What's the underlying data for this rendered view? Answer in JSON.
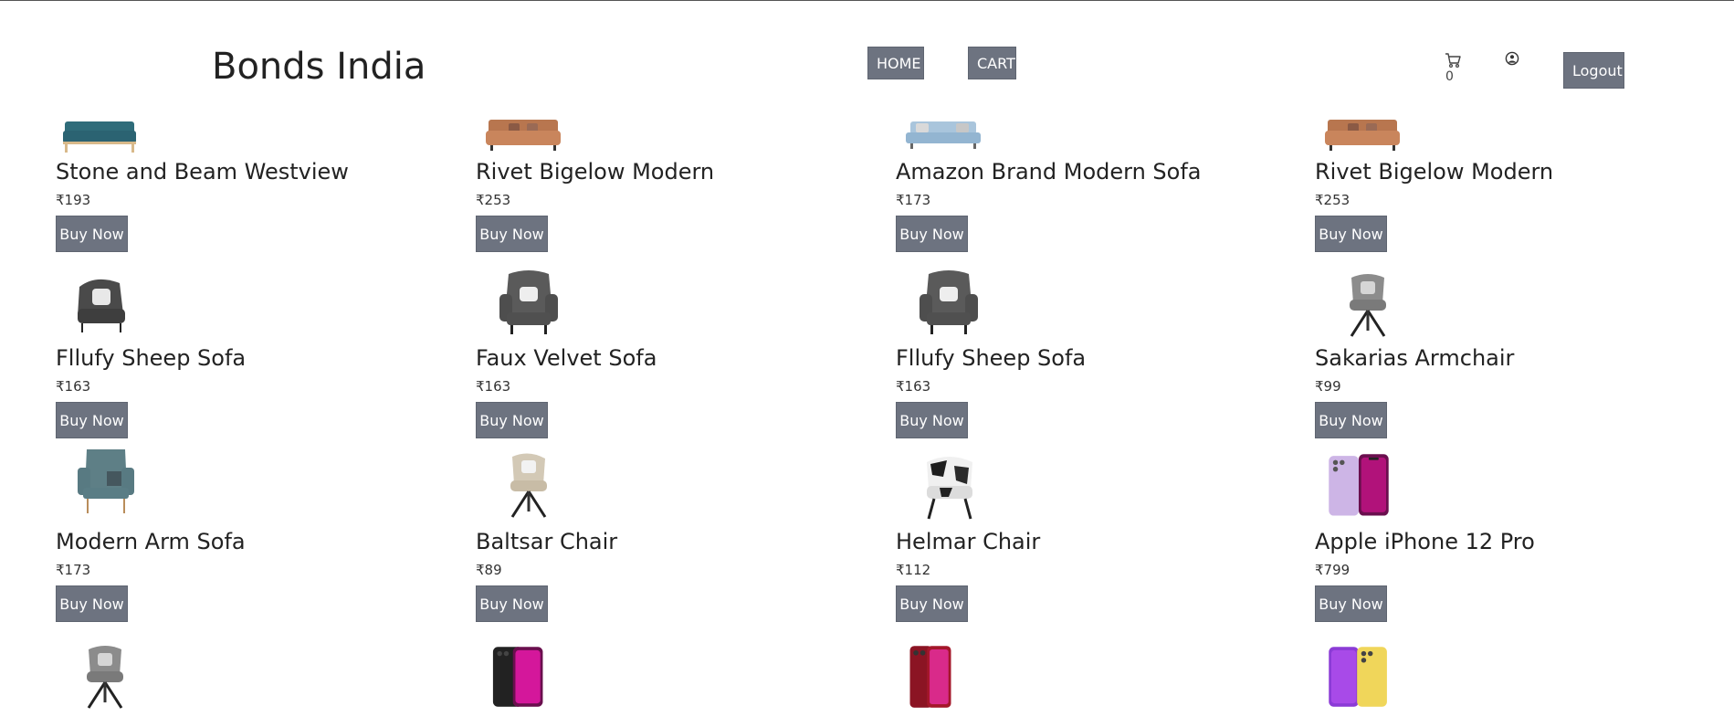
{
  "header": {
    "brand": "Bonds India",
    "nav": {
      "home_label": "HOME",
      "cart_label": "CART"
    },
    "cart_count": "0",
    "logout_label": "Logout"
  },
  "buy_label": "Buy Now",
  "colors": {
    "button_bg": "#6d7380",
    "button_text": "#ffffff",
    "text": "#222222"
  },
  "products": [
    {
      "name": "Stone and Beam Westview",
      "price": "₹193",
      "image": "teal-sofa"
    },
    {
      "name": "Rivet Bigelow Modern",
      "price": "₹253",
      "image": "tan-leather-sofa"
    },
    {
      "name": "Amazon Brand Modern Sofa",
      "price": "₹173",
      "image": "light-blue-sofa"
    },
    {
      "name": "Rivet Bigelow Modern",
      "price": "₹253",
      "image": "tan-leather-sofa"
    },
    {
      "name": "Fllufy Sheep Sofa",
      "price": "₹163",
      "image": "grey-armchair"
    },
    {
      "name": "Faux Velvet Sofa",
      "price": "₹163",
      "image": "grey-wingback-chair"
    },
    {
      "name": "Fllufy Sheep Sofa",
      "price": "₹163",
      "image": "grey-wingback-chair"
    },
    {
      "name": "Sakarias Armchair",
      "price": "₹99",
      "image": "grey-swivel-chair"
    },
    {
      "name": "Modern Arm Sofa",
      "price": "₹173",
      "image": "teal-wingback-chair"
    },
    {
      "name": "Baltsar Chair",
      "price": "₹89",
      "image": "beige-swivel-chair"
    },
    {
      "name": "Helmar Chair",
      "price": "₹112",
      "image": "cowhide-chair"
    },
    {
      "name": "Apple iPhone 12 Pro",
      "price": "₹799",
      "image": "purple-phones"
    },
    {
      "name": "",
      "price": "",
      "image": "grey-swivel-chair"
    },
    {
      "name": "",
      "price": "",
      "image": "black-pink-phones"
    },
    {
      "name": "",
      "price": "",
      "image": "red-phone"
    },
    {
      "name": "",
      "price": "",
      "image": "purple-yellow-phones"
    }
  ]
}
